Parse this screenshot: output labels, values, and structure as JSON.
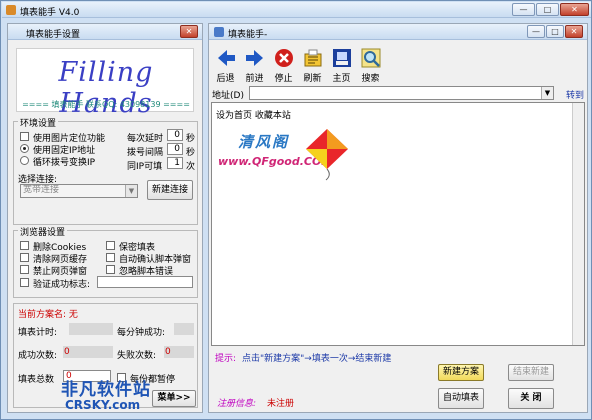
{
  "window": {
    "title": "填表能手 V4.0",
    "min": "—",
    "max": "□",
    "close": "✕"
  },
  "settings": {
    "title": "填表能手设置",
    "close": "✕"
  },
  "logo": {
    "text": "Filling Hands",
    "subtitle": "==== 填表能手 联系QQ: 43098139 ===="
  },
  "env": {
    "group": "环境设置",
    "opt_image": "使用图片定位功能",
    "opt_fixed_ip": "使用固定IP地址",
    "opt_cycle_dial": "循环拨号变换IP",
    "delay_label": "每次延时",
    "delay_value": "0",
    "delay_unit": "秒",
    "interval_label": "拨号间隔",
    "interval_value": "0",
    "interval_unit": "秒",
    "same_ip_label": "同IP可填",
    "same_ip_value": "1",
    "same_ip_unit": "次",
    "select_label": "选择连接:",
    "select_value": "宽带连接",
    "new_conn": "新建连接"
  },
  "browser": {
    "group": "浏览器设置",
    "del_cookies": "删除Cookies",
    "keep_fill": "保密填表",
    "clear_cache": "清除网页缓存",
    "auto_confirm": "自动确认脚本弹窗",
    "block_popup": "禁止网页弹窗",
    "ignore_err": "忽略脚本错误",
    "verify": "验证成功标志:"
  },
  "scheme": {
    "current": "当前方案名: 无",
    "fill_time": "填表计时:",
    "per_min": "每分钟成功:",
    "success_label": "成功次数:",
    "success_value": "0",
    "fail_label": "失败次数:",
    "fail_value": "0",
    "total_label": "填表总数",
    "total_value": "0",
    "pause": "每份都暂停",
    "load": "菜单>>"
  },
  "right": {
    "title": "填表能手-",
    "min": "—",
    "max": "□",
    "close": "✕",
    "toolbar": [
      "后退",
      "前进",
      "停止",
      "刷新",
      "主页",
      "搜索"
    ],
    "addr_label": "地址(D)",
    "addr_value": "",
    "go": "转到",
    "links": "设为首页  收藏本站",
    "watermark1": "清风阁",
    "watermark2": "www.QFgood.COM",
    "tip_label": "提示:",
    "tip_text": "点击\"新建方案\"→填表一次→结束新建",
    "new_scheme": "新建方案",
    "end_new": "结束新建",
    "auto_fill": "自动填表",
    "close_btn": "关 闭",
    "reg_label": "注册信息:",
    "reg_value": "未注册"
  },
  "site": {
    "name": "非凡软件站",
    "url": "CRSKY.com"
  }
}
